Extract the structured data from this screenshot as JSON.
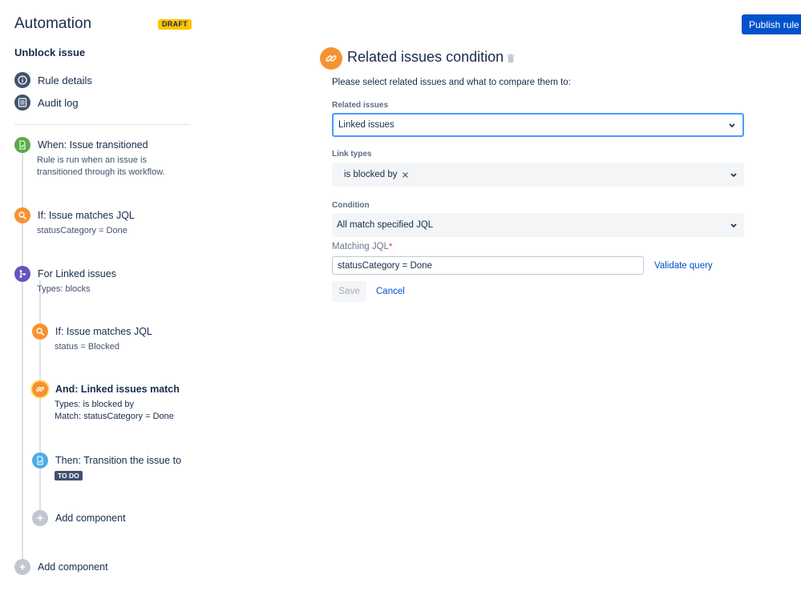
{
  "header": {
    "app_title": "Automation",
    "draft_badge": "DRAFT",
    "publish_label": "Publish rule"
  },
  "sidebar": {
    "rule_name": "Unblock issue",
    "nav": [
      {
        "label": "Rule details",
        "icon": "info-icon"
      },
      {
        "label": "Audit log",
        "icon": "list-icon"
      }
    ],
    "steps": {
      "trigger": {
        "title": "When: Issue transitioned",
        "desc_line1": "Rule is run when an issue is",
        "desc_line2": "transitioned through its workflow.",
        "icon": "transition-icon"
      },
      "condition1": {
        "title": "If: Issue matches JQL",
        "desc": "statusCategory = Done",
        "icon": "search-icon"
      },
      "branch": {
        "title": "For Linked issues",
        "desc": "Types: blocks",
        "icon": "branch-icon"
      },
      "condition2": {
        "title": "If: Issue matches JQL",
        "desc": "status = Blocked",
        "icon": "search-icon"
      },
      "condition3": {
        "title": "And: Linked issues match",
        "desc_line1": "Types: is blocked by",
        "desc_line2": "Match: statusCategory = Done",
        "icon": "link-icon"
      },
      "action": {
        "title": "Then: Transition the issue to",
        "badge": "TO DO",
        "icon": "transition-icon"
      },
      "add_inner": {
        "title": "Add component",
        "icon": "plus-icon"
      },
      "add_outer": {
        "title": "Add component",
        "icon": "plus-icon"
      }
    }
  },
  "main": {
    "title": "Related issues condition",
    "instruction": "Please select related issues and what to compare them to:",
    "related_issues": {
      "label": "Related issues",
      "value": "Linked issues"
    },
    "link_types": {
      "label": "Link types",
      "chip": "is blocked by"
    },
    "condition": {
      "label": "Condition",
      "value": "All match specified JQL"
    },
    "matching_jql": {
      "label": "Matching JQL",
      "required_mark": "*",
      "value": "statusCategory = Done"
    },
    "validate_label": "Validate query",
    "save_label": "Save",
    "cancel_label": "Cancel"
  },
  "colors": {
    "primary": "#0052CC",
    "draft": "#FFC400",
    "trigger": "#5AAC44",
    "condition": "#F79232",
    "branch": "#6554C0",
    "action": "#4BADE8",
    "focus": "#4C9AFF"
  }
}
